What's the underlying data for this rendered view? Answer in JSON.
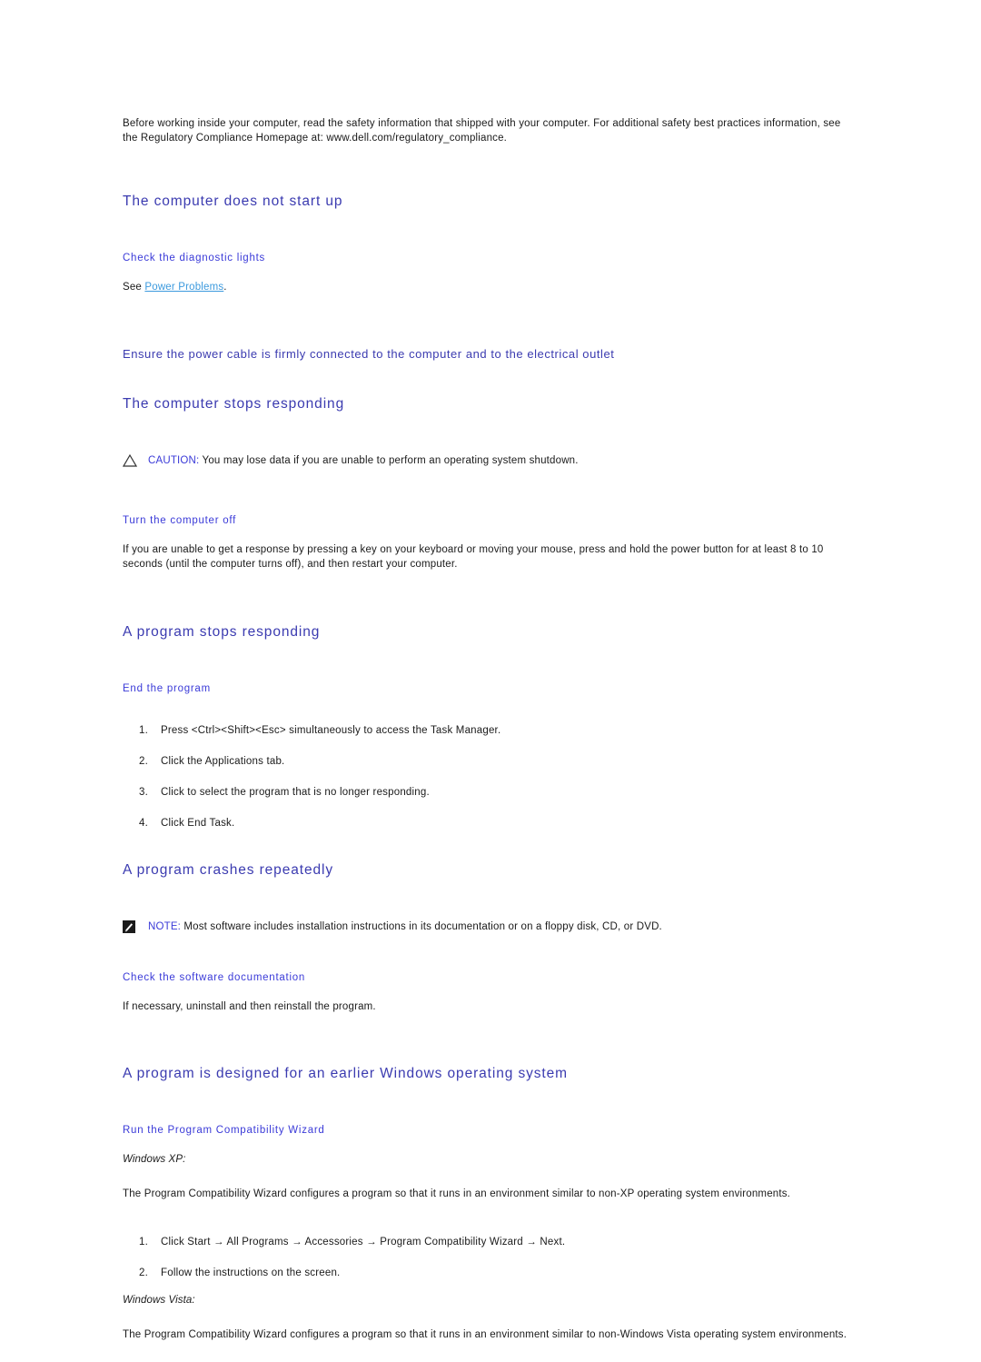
{
  "colors": {
    "section_heading": "#3b3bb0",
    "sub_heading": "#3a3ad8",
    "link": "#3c9ade",
    "body_text": "#1a1a1a"
  },
  "intro": {
    "text": "Before working inside your computer, read the safety information that shipped with your computer. For additional safety best practices information, see the Regulatory Compliance Homepage at: www.dell.com/regulatory_compliance."
  },
  "sections": [
    {
      "heading": "The computer does not start up",
      "sub_heading": "Check the diagnostic lights",
      "see_prefix": "See ",
      "link_text": "Power Problems",
      "see_suffix": ".",
      "wide_sub_heading": "Ensure the power cable is firmly connected to the computer and to the electrical outlet"
    },
    {
      "heading": "The computer stops responding",
      "caution_label": "CAUTION:",
      "caution_text": " You may lose data if you are unable to perform an operating system shutdown.",
      "caution_icon": "warning-triangle-icon",
      "sub_heading": "Turn the computer off",
      "body": "If you are unable to get a response by pressing a key on your keyboard or moving your mouse, press and hold the power button for at least 8 to 10 seconds (until the computer turns off), and then restart your computer."
    },
    {
      "heading": "A program stops responding",
      "sub_heading": "End the program",
      "steps": [
        "Press <Ctrl><Shift><Esc> simultaneously to access the Task Manager.",
        "Click the Applications tab.",
        "Click to select the program that is no longer responding.",
        "Click End Task."
      ]
    },
    {
      "heading": "A program crashes repeatedly",
      "note_label": "NOTE:",
      "note_text": " Most software includes installation instructions in its documentation or on a floppy disk, CD, or DVD.",
      "note_icon": "note-pencil-icon",
      "sub_heading": "Check the software documentation",
      "body": "If necessary, uninstall and then reinstall the program."
    },
    {
      "heading": "A program is designed for an earlier Windows operating system",
      "sub_heading": "Run the Program Compatibility Wizard",
      "xp_label": "Windows XP:",
      "xp_body": "The Program Compatibility Wizard configures a program so that it runs in an environment similar to non-XP operating system environments.",
      "xp_steps": [
        "Click Start → All Programs → Accessories → Program Compatibility Wizard → Next.",
        "Follow the instructions on the screen."
      ],
      "vista_label": "Windows Vista:",
      "vista_body": "The Program Compatibility Wizard configures a program so that it runs in an environment similar to non-Windows Vista operating system environments."
    }
  ]
}
